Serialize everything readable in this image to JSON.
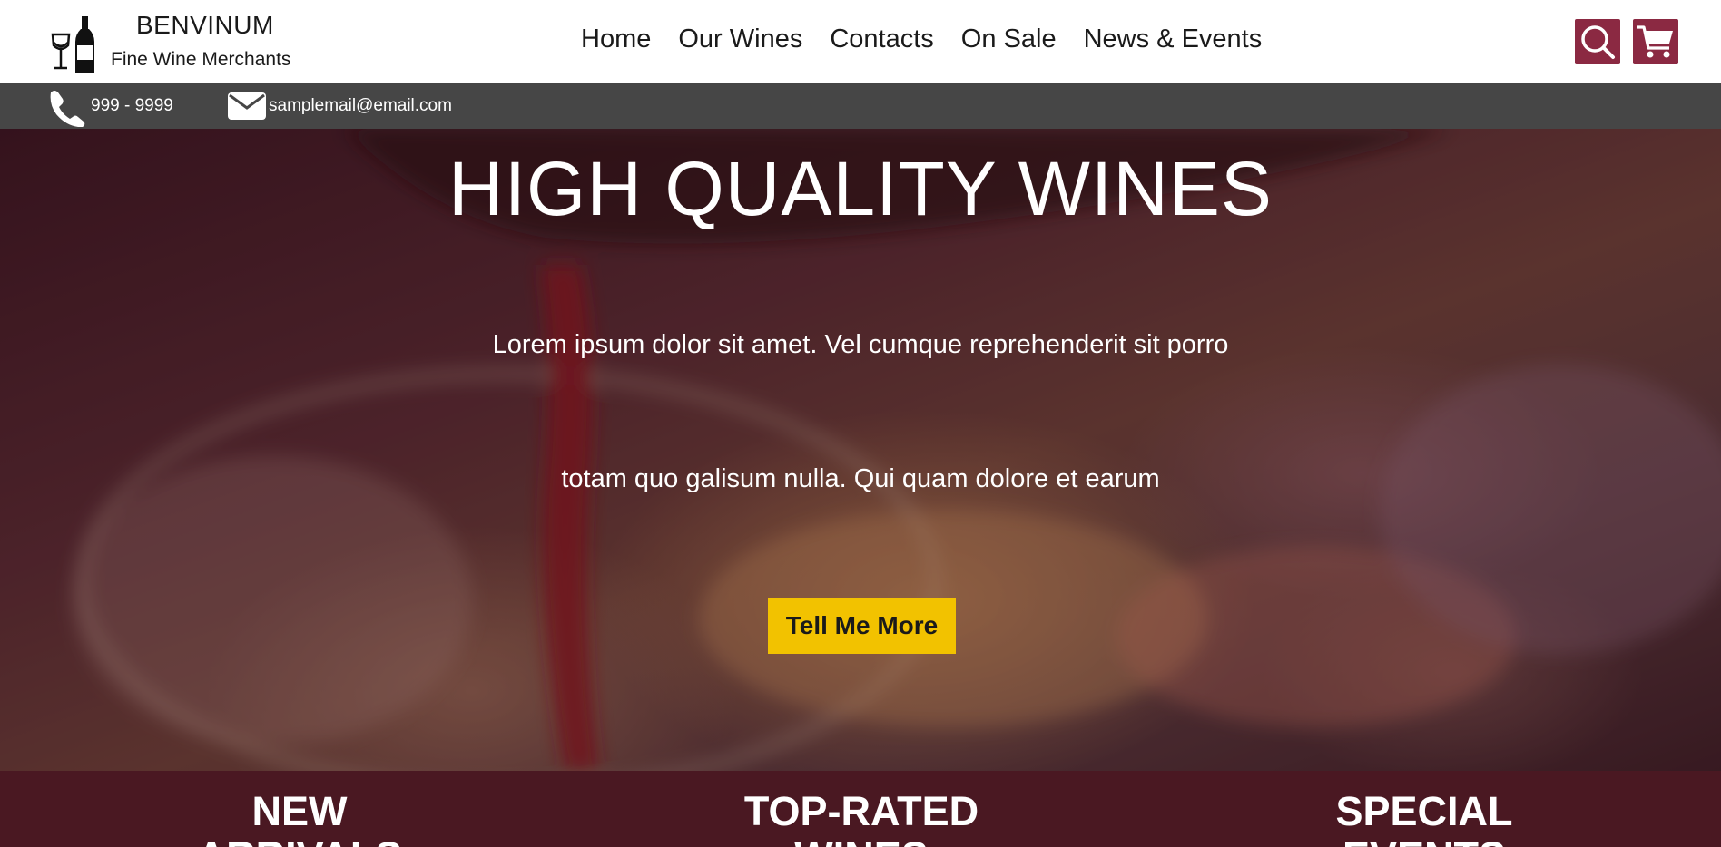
{
  "brand": {
    "name": "BENVINUM",
    "tagline": "Fine Wine Merchants",
    "logo_icon": "wine-bottle-glass-icon"
  },
  "nav": {
    "items": [
      {
        "label": "Home"
      },
      {
        "label": "Our Wines"
      },
      {
        "label": "Contacts"
      },
      {
        "label": "On Sale"
      },
      {
        "label": "News & Events"
      }
    ],
    "search_icon": "search-icon",
    "cart_icon": "cart-icon"
  },
  "contact": {
    "phone": "999 - 9999",
    "email": "samplemail@email.com"
  },
  "hero": {
    "title": "HIGH QUALITY WINES",
    "line1": "Lorem ipsum dolor sit amet. Vel cumque reprehenderit sit porro",
    "line2": "totam quo galisum nulla. Qui quam dolore et earum",
    "cta": "Tell Me More"
  },
  "features": [
    {
      "title": "NEW ARRIVALS"
    },
    {
      "title": "TOP-RATED WINES"
    },
    {
      "title": "SPECIAL EVENTS"
    }
  ],
  "colors": {
    "accent": "#8b2942",
    "cta": "#f2c200",
    "contact_bar": "#464646",
    "feature_strip": "#4a1822"
  }
}
